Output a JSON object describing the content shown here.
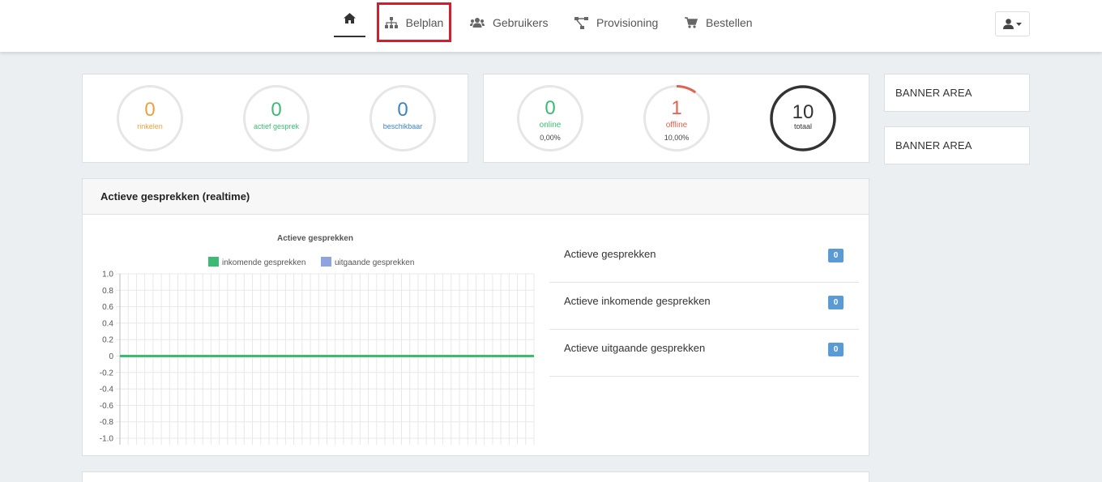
{
  "nav": {
    "home_icon": "home-icon",
    "items": [
      {
        "label": "Belplan",
        "icon": "sitemap-icon"
      },
      {
        "label": "Gebruikers",
        "icon": "users-icon"
      },
      {
        "label": "Provisioning",
        "icon": "network-icon"
      },
      {
        "label": "Bestellen",
        "icon": "cart-icon"
      }
    ],
    "user_icon": "user-icon"
  },
  "calls": [
    {
      "value": "0",
      "label": "rinkelen",
      "color": "#e8a33d"
    },
    {
      "value": "0",
      "label": "actief gesprek",
      "color": "#3dbb73"
    },
    {
      "value": "0",
      "label": "beschikbaar",
      "color": "#3a86c0"
    }
  ],
  "devices": [
    {
      "value": "0",
      "label": "online",
      "pct": "0,00%",
      "color": "#3dbb73",
      "fraction": 0
    },
    {
      "value": "1",
      "label": "offline",
      "pct": "10,00%",
      "color": "#e0624f",
      "fraction": 0.1
    },
    {
      "value": "10",
      "label": "totaal",
      "pct": "",
      "color": "#333333",
      "fraction": 1
    }
  ],
  "banners": [
    "BANNER AREA",
    "BANNER AREA"
  ],
  "realtime": {
    "title": "Actieve gesprekken (realtime)",
    "list": [
      {
        "label": "Actieve gesprekken",
        "count": "0"
      },
      {
        "label": "Actieve inkomende gesprekken",
        "count": "0"
      },
      {
        "label": "Actieve uitgaande gesprekken",
        "count": "0"
      }
    ]
  },
  "chart_data": {
    "type": "line",
    "title": "Actieve gesprekken",
    "legend": "top",
    "series": [
      {
        "name": "inkomende gesprekken",
        "color": "#3dbb73",
        "values": [
          0,
          0,
          0,
          0,
          0,
          0,
          0,
          0,
          0,
          0,
          0,
          0,
          0,
          0,
          0,
          0,
          0,
          0,
          0,
          0,
          0,
          0,
          0,
          0,
          0,
          0,
          0,
          0,
          0,
          0,
          0,
          0,
          0,
          0,
          0,
          0,
          0,
          0,
          0,
          0,
          0,
          0,
          0,
          0,
          0,
          0,
          0,
          0,
          0,
          0,
          0
        ]
      },
      {
        "name": "uitgaande gesprekken",
        "color": "#8ea3df",
        "values": [
          0,
          0,
          0,
          0,
          0,
          0,
          0,
          0,
          0,
          0,
          0,
          0,
          0,
          0,
          0,
          0,
          0,
          0,
          0,
          0,
          0,
          0,
          0,
          0,
          0,
          0,
          0,
          0,
          0,
          0,
          0,
          0,
          0,
          0,
          0,
          0,
          0,
          0,
          0,
          0,
          0,
          0,
          0,
          0,
          0,
          0,
          0,
          0,
          0,
          0,
          0
        ]
      }
    ],
    "ylim": [
      -1.0,
      1.0
    ],
    "yticks": [
      "1.0",
      "0.8",
      "0.6",
      "0.4",
      "0.2",
      "0",
      "-0.2",
      "-0.4",
      "-0.6",
      "-0.8",
      "-1.0"
    ],
    "grid": true,
    "xlabel": "",
    "ylabel": ""
  }
}
